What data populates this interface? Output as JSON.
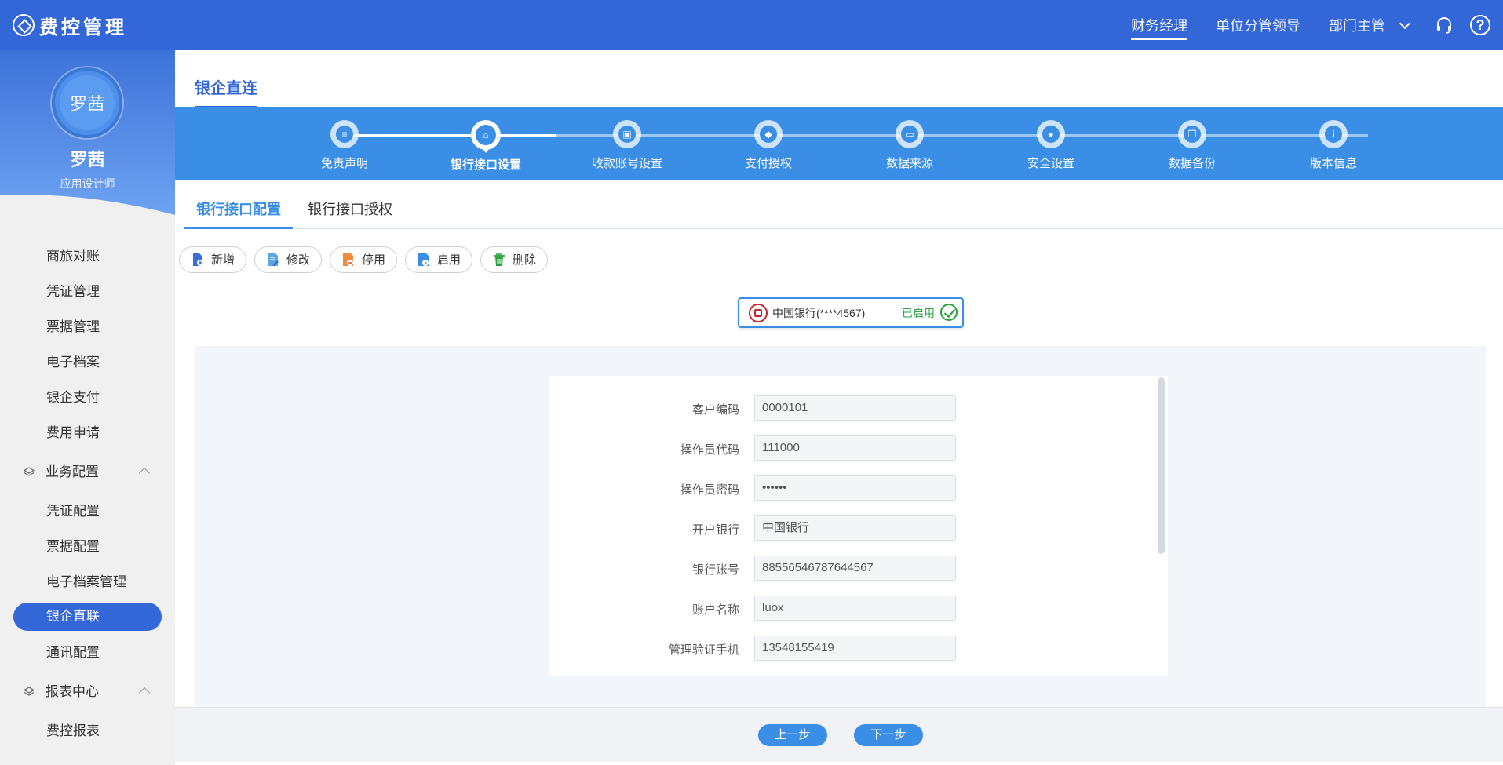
{
  "app": {
    "title": "费控管理"
  },
  "topnav": {
    "roles": [
      "财务经理",
      "单位分管领导",
      "部门主管"
    ],
    "active_role": "财务经理"
  },
  "profile": {
    "avatar_text": "罗茜",
    "name": "罗茜",
    "role": "应用设计师"
  },
  "sidebar": {
    "items_top": [
      "商旅对账",
      "凭证管理",
      "票据管理",
      "电子档案",
      "银企支付",
      "费用申请"
    ],
    "group1": "业务配置",
    "items_mid": [
      "凭证配置",
      "票据配置",
      "电子档案管理",
      "银企直联",
      "通讯配置"
    ],
    "group2": "报表中心",
    "items_bottom": [
      "费控报表"
    ],
    "active": "银企直联"
  },
  "page": {
    "tab": "银企直连"
  },
  "steps": {
    "labels": [
      "免责声明",
      "银行接口设置",
      "收款账号设置",
      "支付授权",
      "数据来源",
      "安全设置",
      "数据备份",
      "版本信息"
    ],
    "current": "银行接口设置"
  },
  "subtabs": [
    "银行接口配置",
    "银行接口授权"
  ],
  "toolbar": {
    "add": "新增",
    "edit": "修改",
    "disable": "停用",
    "enable": "启用",
    "delete": "删除"
  },
  "bank_card": {
    "name": "中国银行(****4567)",
    "status": "已启用"
  },
  "form": {
    "fields": [
      {
        "label": "客户编码",
        "value": "0000101"
      },
      {
        "label": "操作员代码",
        "value": "111000"
      },
      {
        "label": "操作员密码",
        "value": "••••••"
      },
      {
        "label": "开户银行",
        "value": "中国银行"
      },
      {
        "label": "银行账号",
        "value": "88556546787644567"
      },
      {
        "label": "账户名称",
        "value": "luox"
      },
      {
        "label": "管理验证手机",
        "value": "13548155419"
      }
    ]
  },
  "footer": {
    "prev": "上一步",
    "next": "下一步"
  },
  "colors": {
    "primary": "#3366d6",
    "accent": "#3a8ee6",
    "success": "#2aa13b",
    "bank_red": "#c0282d"
  }
}
